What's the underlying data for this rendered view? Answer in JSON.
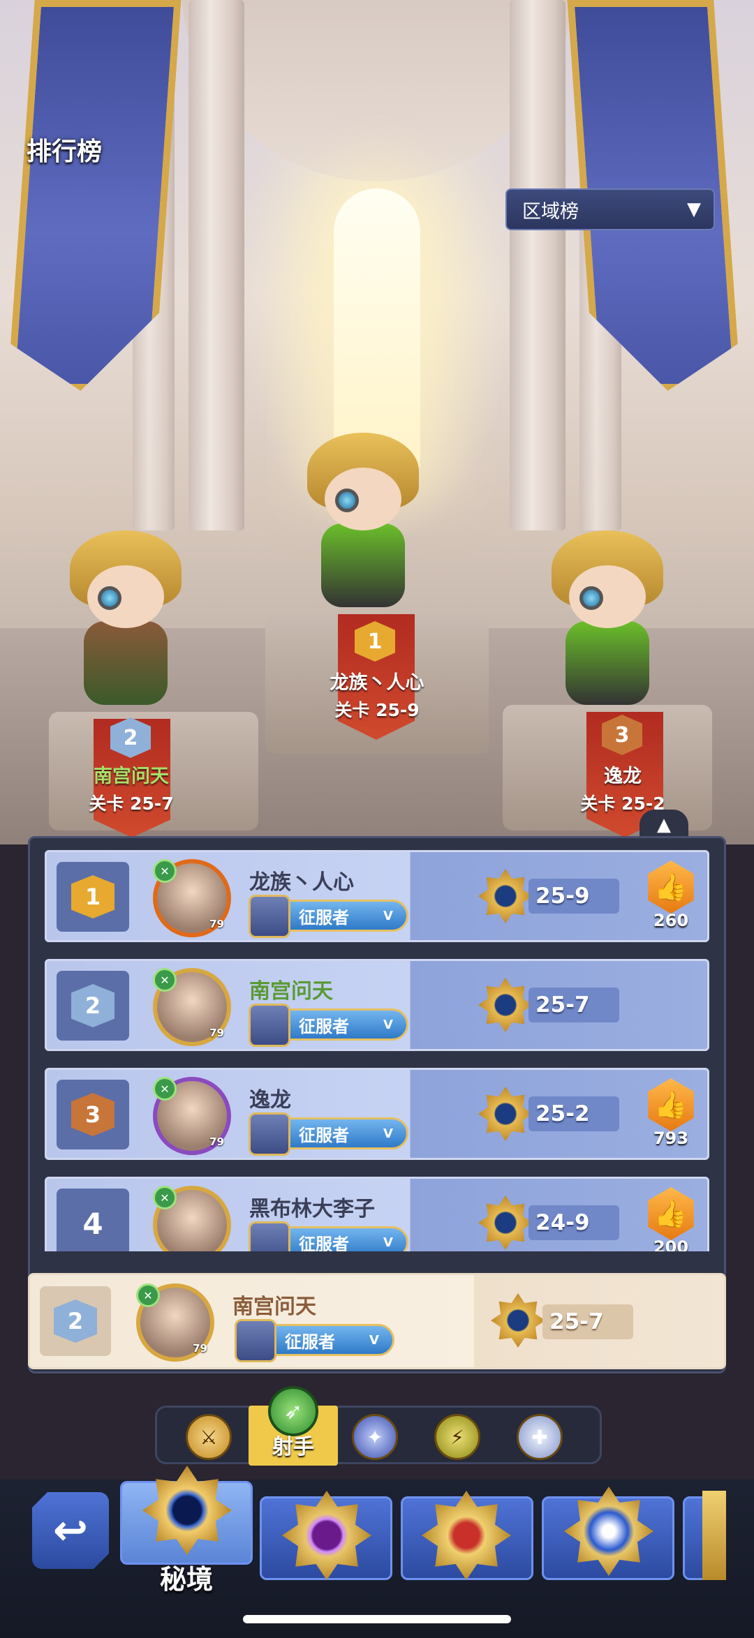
{
  "header": {
    "title": "排行榜"
  },
  "filter": {
    "label": "区域榜",
    "icon": "chevron-down-icon"
  },
  "podium": [
    {
      "rank": "1",
      "name": "龙族丶人心",
      "stage": "关卡 25-9",
      "name_color": "#ffffff"
    },
    {
      "rank": "2",
      "name": "南宫问天",
      "stage": "关卡 25-7",
      "name_color": "#a6e06a"
    },
    {
      "rank": "3",
      "name": "逸龙",
      "stage": "关卡 25-2",
      "name_color": "#ffffff"
    }
  ],
  "leaderboard": {
    "collapse_icon": "chevron-up-icon",
    "rows": [
      {
        "rank": "1",
        "name": "龙族丶人心",
        "name_color": "#3a3f58",
        "level": "79",
        "title": "征服者",
        "title_tier": "V",
        "stage": "25-9",
        "likes": "260",
        "badge_color": "#e7a92f"
      },
      {
        "rank": "2",
        "name": "南宫问天",
        "name_color": "#5a9a34",
        "level": "79",
        "title": "征服者",
        "title_tier": "V",
        "stage": "25-7",
        "likes": null,
        "badge_color": "#8fb0d8"
      },
      {
        "rank": "3",
        "name": "逸龙",
        "name_color": "#3a3f58",
        "level": "79",
        "title": "征服者",
        "title_tier": "V",
        "stage": "25-2",
        "likes": "793",
        "badge_color": "#c8753a"
      },
      {
        "rank": "4",
        "name": "黑布林大李子",
        "name_color": "#3a3f58",
        "level": "",
        "title": "征服者",
        "title_tier": "V",
        "stage": "24-9",
        "likes": "200",
        "badge_color": null
      }
    ]
  },
  "self": {
    "rank": "2",
    "name": "南宫问天",
    "level": "79",
    "title": "征服者",
    "title_tier": "V",
    "stage": "25-7"
  },
  "class_tabs": [
    {
      "name": "warrior-class",
      "icon": "axe-icon"
    },
    {
      "name": "archer-class",
      "label": "射手",
      "icon": "bow-icon",
      "active": true
    },
    {
      "name": "mage-class",
      "icon": "staff-icon"
    },
    {
      "name": "assassin-class",
      "icon": "dagger-icon"
    },
    {
      "name": "priest-class",
      "icon": "cross-icon"
    }
  ],
  "bottom_nav": {
    "back_icon": "return-arrow-icon",
    "tabs": [
      {
        "label": "秘境",
        "active": true,
        "icon": "eye-emblem-icon"
      },
      {
        "label": "",
        "icon": "purple-gem-emblem-icon"
      },
      {
        "label": "",
        "icon": "crown-emblem-icon"
      },
      {
        "label": "",
        "icon": "star-emblem-icon"
      },
      {
        "label": "",
        "icon": "partial-emblem-icon"
      }
    ]
  }
}
